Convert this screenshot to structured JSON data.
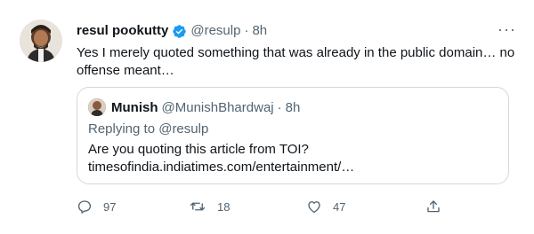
{
  "tweet": {
    "author_name": "resul pookutty",
    "handle": "@resulp",
    "separator": "·",
    "time": "8h",
    "more": "···",
    "text": "Yes I merely quoted something that was already in the public domain… no offense meant…",
    "verified_icon": "verified-badge-icon",
    "accent": "#1d9bf0"
  },
  "quoted": {
    "author_name": "Munish",
    "handle": "@MunishBhardwaj",
    "separator": "·",
    "time": "8h",
    "replying_to": "Replying to @resulp",
    "text_line1": "Are you quoting this article from TOI?",
    "text_line2": "timesofindia.indiatimes.com/entertainment/…"
  },
  "actions": {
    "reply": {
      "icon": "reply-icon",
      "count": "97"
    },
    "retweet": {
      "icon": "retweet-icon",
      "count": "18"
    },
    "like": {
      "icon": "heart-icon",
      "count": "47"
    },
    "share": {
      "icon": "share-icon"
    }
  }
}
